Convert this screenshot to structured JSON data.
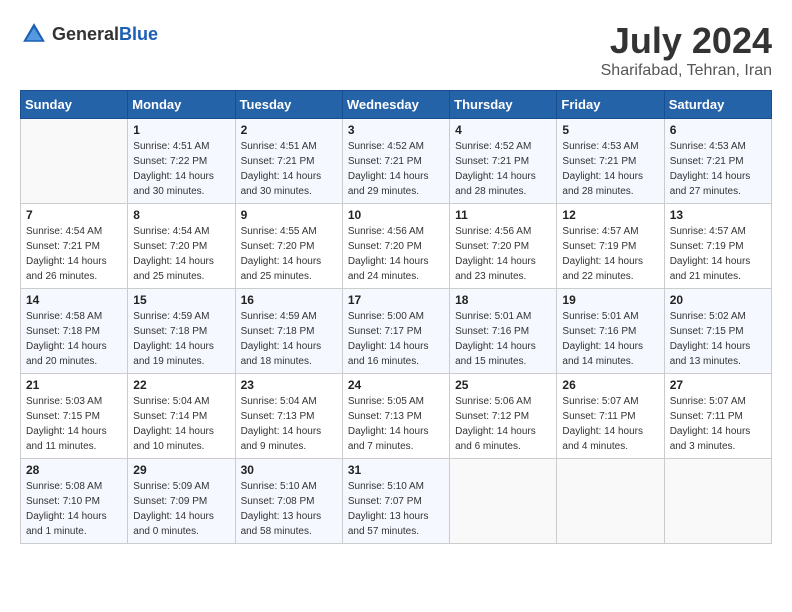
{
  "header": {
    "logo_general": "General",
    "logo_blue": "Blue",
    "title": "July 2024",
    "location": "Sharifabad, Tehran, Iran"
  },
  "calendar": {
    "weekdays": [
      "Sunday",
      "Monday",
      "Tuesday",
      "Wednesday",
      "Thursday",
      "Friday",
      "Saturday"
    ],
    "weeks": [
      [
        {
          "day": "",
          "sunrise": "",
          "sunset": "",
          "daylight": ""
        },
        {
          "day": "1",
          "sunrise": "Sunrise: 4:51 AM",
          "sunset": "Sunset: 7:22 PM",
          "daylight": "Daylight: 14 hours and 30 minutes."
        },
        {
          "day": "2",
          "sunrise": "Sunrise: 4:51 AM",
          "sunset": "Sunset: 7:21 PM",
          "daylight": "Daylight: 14 hours and 30 minutes."
        },
        {
          "day": "3",
          "sunrise": "Sunrise: 4:52 AM",
          "sunset": "Sunset: 7:21 PM",
          "daylight": "Daylight: 14 hours and 29 minutes."
        },
        {
          "day": "4",
          "sunrise": "Sunrise: 4:52 AM",
          "sunset": "Sunset: 7:21 PM",
          "daylight": "Daylight: 14 hours and 28 minutes."
        },
        {
          "day": "5",
          "sunrise": "Sunrise: 4:53 AM",
          "sunset": "Sunset: 7:21 PM",
          "daylight": "Daylight: 14 hours and 28 minutes."
        },
        {
          "day": "6",
          "sunrise": "Sunrise: 4:53 AM",
          "sunset": "Sunset: 7:21 PM",
          "daylight": "Daylight: 14 hours and 27 minutes."
        }
      ],
      [
        {
          "day": "7",
          "sunrise": "Sunrise: 4:54 AM",
          "sunset": "Sunset: 7:21 PM",
          "daylight": "Daylight: 14 hours and 26 minutes."
        },
        {
          "day": "8",
          "sunrise": "Sunrise: 4:54 AM",
          "sunset": "Sunset: 7:20 PM",
          "daylight": "Daylight: 14 hours and 25 minutes."
        },
        {
          "day": "9",
          "sunrise": "Sunrise: 4:55 AM",
          "sunset": "Sunset: 7:20 PM",
          "daylight": "Daylight: 14 hours and 25 minutes."
        },
        {
          "day": "10",
          "sunrise": "Sunrise: 4:56 AM",
          "sunset": "Sunset: 7:20 PM",
          "daylight": "Daylight: 14 hours and 24 minutes."
        },
        {
          "day": "11",
          "sunrise": "Sunrise: 4:56 AM",
          "sunset": "Sunset: 7:20 PM",
          "daylight": "Daylight: 14 hours and 23 minutes."
        },
        {
          "day": "12",
          "sunrise": "Sunrise: 4:57 AM",
          "sunset": "Sunset: 7:19 PM",
          "daylight": "Daylight: 14 hours and 22 minutes."
        },
        {
          "day": "13",
          "sunrise": "Sunrise: 4:57 AM",
          "sunset": "Sunset: 7:19 PM",
          "daylight": "Daylight: 14 hours and 21 minutes."
        }
      ],
      [
        {
          "day": "14",
          "sunrise": "Sunrise: 4:58 AM",
          "sunset": "Sunset: 7:18 PM",
          "daylight": "Daylight: 14 hours and 20 minutes."
        },
        {
          "day": "15",
          "sunrise": "Sunrise: 4:59 AM",
          "sunset": "Sunset: 7:18 PM",
          "daylight": "Daylight: 14 hours and 19 minutes."
        },
        {
          "day": "16",
          "sunrise": "Sunrise: 4:59 AM",
          "sunset": "Sunset: 7:18 PM",
          "daylight": "Daylight: 14 hours and 18 minutes."
        },
        {
          "day": "17",
          "sunrise": "Sunrise: 5:00 AM",
          "sunset": "Sunset: 7:17 PM",
          "daylight": "Daylight: 14 hours and 16 minutes."
        },
        {
          "day": "18",
          "sunrise": "Sunrise: 5:01 AM",
          "sunset": "Sunset: 7:16 PM",
          "daylight": "Daylight: 14 hours and 15 minutes."
        },
        {
          "day": "19",
          "sunrise": "Sunrise: 5:01 AM",
          "sunset": "Sunset: 7:16 PM",
          "daylight": "Daylight: 14 hours and 14 minutes."
        },
        {
          "day": "20",
          "sunrise": "Sunrise: 5:02 AM",
          "sunset": "Sunset: 7:15 PM",
          "daylight": "Daylight: 14 hours and 13 minutes."
        }
      ],
      [
        {
          "day": "21",
          "sunrise": "Sunrise: 5:03 AM",
          "sunset": "Sunset: 7:15 PM",
          "daylight": "Daylight: 14 hours and 11 minutes."
        },
        {
          "day": "22",
          "sunrise": "Sunrise: 5:04 AM",
          "sunset": "Sunset: 7:14 PM",
          "daylight": "Daylight: 14 hours and 10 minutes."
        },
        {
          "day": "23",
          "sunrise": "Sunrise: 5:04 AM",
          "sunset": "Sunset: 7:13 PM",
          "daylight": "Daylight: 14 hours and 9 minutes."
        },
        {
          "day": "24",
          "sunrise": "Sunrise: 5:05 AM",
          "sunset": "Sunset: 7:13 PM",
          "daylight": "Daylight: 14 hours and 7 minutes."
        },
        {
          "day": "25",
          "sunrise": "Sunrise: 5:06 AM",
          "sunset": "Sunset: 7:12 PM",
          "daylight": "Daylight: 14 hours and 6 minutes."
        },
        {
          "day": "26",
          "sunrise": "Sunrise: 5:07 AM",
          "sunset": "Sunset: 7:11 PM",
          "daylight": "Daylight: 14 hours and 4 minutes."
        },
        {
          "day": "27",
          "sunrise": "Sunrise: 5:07 AM",
          "sunset": "Sunset: 7:11 PM",
          "daylight": "Daylight: 14 hours and 3 minutes."
        }
      ],
      [
        {
          "day": "28",
          "sunrise": "Sunrise: 5:08 AM",
          "sunset": "Sunset: 7:10 PM",
          "daylight": "Daylight: 14 hours and 1 minute."
        },
        {
          "day": "29",
          "sunrise": "Sunrise: 5:09 AM",
          "sunset": "Sunset: 7:09 PM",
          "daylight": "Daylight: 14 hours and 0 minutes."
        },
        {
          "day": "30",
          "sunrise": "Sunrise: 5:10 AM",
          "sunset": "Sunset: 7:08 PM",
          "daylight": "Daylight: 13 hours and 58 minutes."
        },
        {
          "day": "31",
          "sunrise": "Sunrise: 5:10 AM",
          "sunset": "Sunset: 7:07 PM",
          "daylight": "Daylight: 13 hours and 57 minutes."
        },
        {
          "day": "",
          "sunrise": "",
          "sunset": "",
          "daylight": ""
        },
        {
          "day": "",
          "sunrise": "",
          "sunset": "",
          "daylight": ""
        },
        {
          "day": "",
          "sunrise": "",
          "sunset": "",
          "daylight": ""
        }
      ]
    ]
  }
}
